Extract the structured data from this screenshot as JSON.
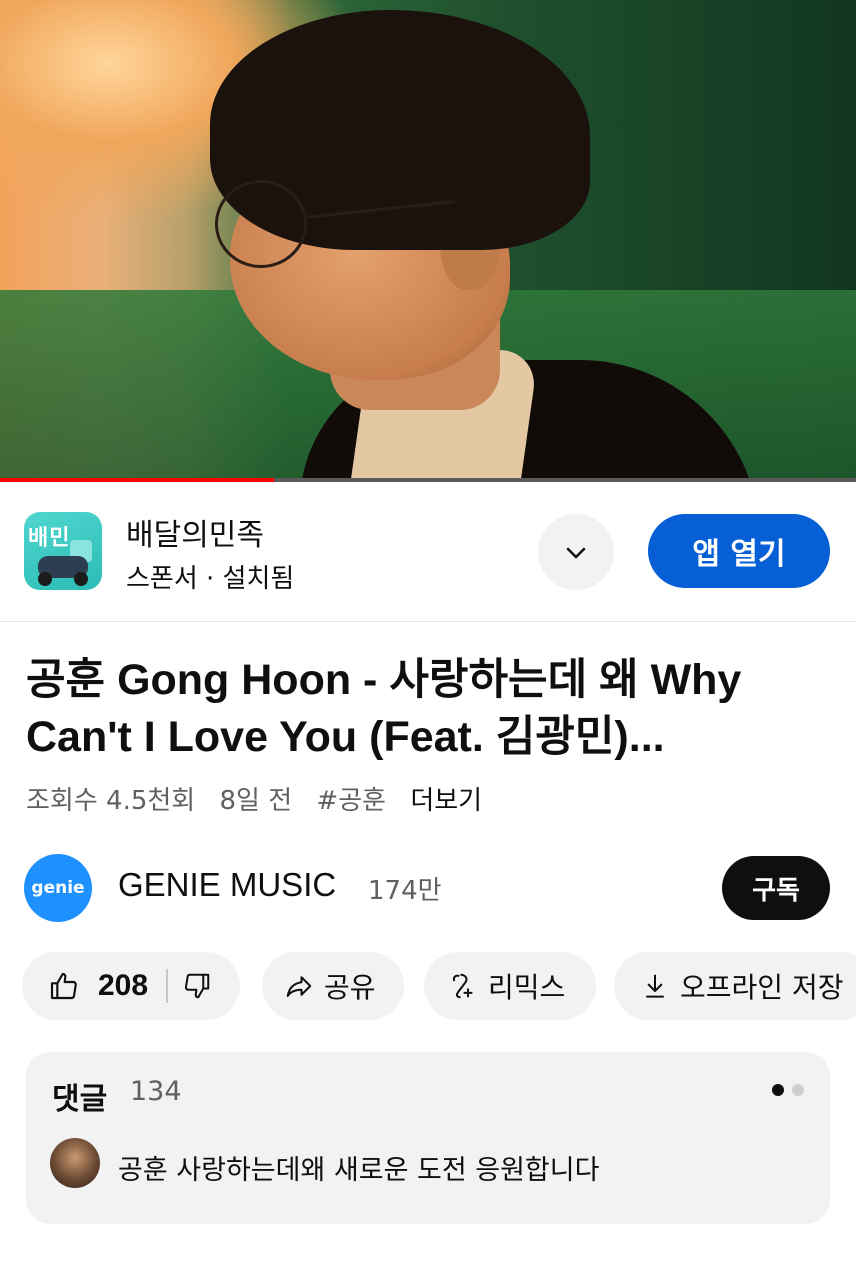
{
  "player": {
    "progress_fraction": 0.32
  },
  "sponsor": {
    "app_name": "배달의민족",
    "subtitle": "스폰서 · 설치됨",
    "open_button": "앱 열기"
  },
  "video": {
    "title": "공훈 Gong Hoon - 사랑하는데 왜 Why Can't I Love You (Feat. 김광민)...",
    "views": "조회수 4.5천회",
    "age": "8일 전",
    "hashtag": "#공훈",
    "more": "더보기"
  },
  "channel": {
    "avatar_text": "genie",
    "name": "GENIE MUSIC",
    "subscribers": "174만",
    "subscribe_button": "구독"
  },
  "actions": {
    "like_count": "208",
    "share": "공유",
    "remix": "리믹스",
    "offline": "오프라인 저장"
  },
  "comments": {
    "title": "댓글",
    "count": "134",
    "top_comment": "공훈 사랑하는데왜 새로운 도전  응원합니다"
  },
  "colors": {
    "accent_blue": "#065fd4",
    "progress_red": "#ff0000",
    "pill_bg": "#f2f2f2"
  }
}
